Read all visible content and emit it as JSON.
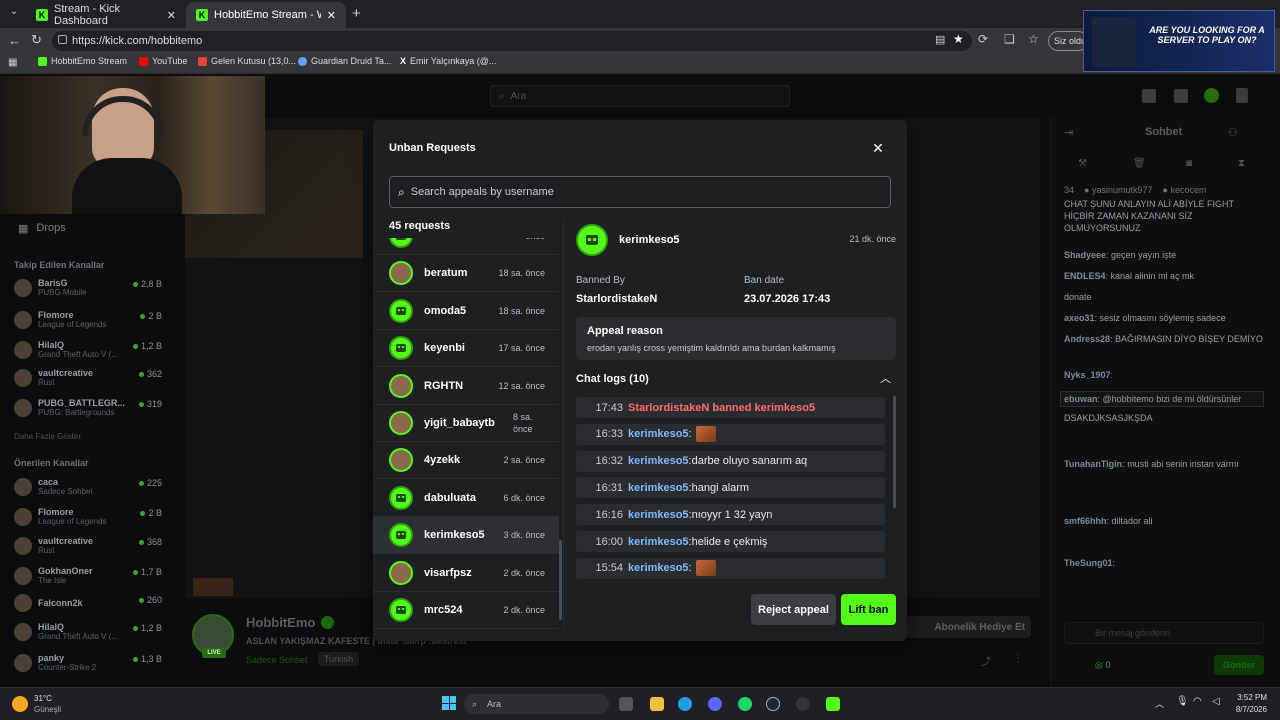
{
  "browser": {
    "tabs": [
      {
        "title": "Stream - Kick Dashboard",
        "active": false
      },
      {
        "title": "HobbitEmo Stream - Watch Live o",
        "active": true
      }
    ],
    "url": "https://kick.com/hobbitemo",
    "profile_button": "Siz oldu",
    "bookmarks": [
      {
        "label": "HobbitEmo Stream",
        "color": "#53fc18"
      },
      {
        "label": "YouTube",
        "color": "#ff0000"
      },
      {
        "label": "Gelen Kutusu (13,0...",
        "color": "#ea4335"
      },
      {
        "label": "Guardian Druid Ta...",
        "color": "#6aa0ff"
      },
      {
        "label": "Emir Yalçınkaya (@...",
        "color": "#ffffff"
      }
    ]
  },
  "ad": {
    "text": "ARE YOU LOOKING FOR A SERVER TO PLAY ON?"
  },
  "page": {
    "search_placeholder": "Ara",
    "sidebar": {
      "drops": "Drops",
      "followed_header": "Takip Edilen Kanallar",
      "followed": [
        {
          "name": "BarisG",
          "game": "PUBG Mobile",
          "count": "2,8 B"
        },
        {
          "name": "Flomore",
          "game": "League of Legends",
          "count": "2 B"
        },
        {
          "name": "HilalQ",
          "game": "Grand Theft Auto V (...",
          "count": "1,2 B"
        },
        {
          "name": "vaultcreative",
          "game": "Rust",
          "count": "362"
        },
        {
          "name": "PUBG_BATTLEGR...",
          "game": "PUBG: Battlegrounds",
          "count": "319"
        }
      ],
      "show_more": "Daha Fazla Göster",
      "recommended_header": "Önerilen Kanallar",
      "recommended": [
        {
          "name": "caca",
          "game": "Sadece Sohbet",
          "count": "225"
        },
        {
          "name": "Flomore",
          "game": "League of Legends",
          "count": "2 B"
        },
        {
          "name": "vaultcreative",
          "game": "Rust",
          "count": "368"
        },
        {
          "name": "GokhanOner",
          "game": "The Isle",
          "count": "1,7 B"
        },
        {
          "name": "Falconn2k",
          "game": "",
          "count": "260"
        },
        {
          "name": "HilalQ",
          "game": "Grand Theft Auto V (...",
          "count": "1,2 B"
        },
        {
          "name": "panky",
          "game": "Counter-Strike 2",
          "count": "1,3 B"
        }
      ]
    },
    "streamer": {
      "name": "HobbitEmo",
      "title": "ASLAN YAKIŞMAZ KAFESTE | insta :bierp :bestrest",
      "category": "Sadece Sohbet",
      "tag": "Turkish",
      "live": "LIVE",
      "subscribe": "Abonelik Hediye Et"
    },
    "chat": {
      "title": "Sohbet",
      "top_count": "34",
      "pinned_users": [
        "yasinumutk977",
        "kecocem"
      ],
      "lines": [
        {
          "user": "",
          "text": "CHAT ŞUNU ANLAYIN ALİ ABİYLE FIGHT HİÇBİR ZAMAN KAZANANI SİZ OLMUYORSUNUZ"
        },
        {
          "user": "Shadyeee",
          "text": "geçen yayın işte"
        },
        {
          "user": "ENDLES4",
          "text": "kanal alinin mi aç mk"
        },
        {
          "user": "",
          "text": "donate"
        },
        {
          "user": "axeo31",
          "text": "sesiz olmasını söylemiş sadece"
        },
        {
          "user": "Andress28",
          "text": "BAĞIRMASIN DİYO BİŞEY DEMİYO"
        },
        {
          "user": "Nyks_1907",
          "text": ""
        },
        {
          "user": "ebuwan",
          "text": "@hobbitemo bizi de mi öldürsünler"
        },
        {
          "user": "",
          "text": "DSAKDJKSASJKŞDA"
        },
        {
          "user": "TunahanTigin",
          "text": "musti abi senin instan varmı"
        },
        {
          "user": "smf66hhh",
          "text": "diltador ali"
        },
        {
          "user": "TheSung01",
          "text": ""
        }
      ],
      "input_placeholder": "Bir mesaj gönderin",
      "send": "Gönder",
      "points": "0"
    }
  },
  "modal": {
    "title": "Unban Requests",
    "search_placeholder": "Search appeals by username",
    "count_label": "45 requests",
    "requests": [
      {
        "username": "",
        "time": "önce",
        "photo": false
      },
      {
        "username": "beratum",
        "time": "18 sa. önce",
        "photo": true
      },
      {
        "username": "omoda5",
        "time": "18 sa. önce",
        "photo": false
      },
      {
        "username": "keyenbi",
        "time": "17 sa. önce",
        "photo": false
      },
      {
        "username": "RGHTN",
        "time": "12 sa. önce",
        "photo": true
      },
      {
        "username": "yigit_babaytb",
        "time": "8 sa. önce",
        "photo": true
      },
      {
        "username": "4yzekk",
        "time": "2 sa. önce",
        "photo": true
      },
      {
        "username": "dabuluata",
        "time": "6 dk. önce",
        "photo": false
      },
      {
        "username": "kerimkeso5",
        "time": "3 dk. önce",
        "photo": false,
        "selected": true
      },
      {
        "username": "visarfpsz",
        "time": "2 dk. önce",
        "photo": true
      },
      {
        "username": "mrc524",
        "time": "2 dk. önce",
        "photo": false
      }
    ],
    "detail": {
      "username": "kerimkeso5",
      "time": "21 dk. önce",
      "banned_by_label": "Banned By",
      "banned_by": "StarlordistakeN",
      "ban_date_label": "Ban date",
      "ban_date": "23.07.2026 17:43",
      "appeal_reason_label": "Appeal reason",
      "appeal_reason": "erodan yanlış cross yemiştim kaldırıldı ama burdan kalkmamış",
      "chat_logs_label": "Chat logs (10)",
      "logs": [
        {
          "time": "17:43",
          "user": "",
          "text": "StarlordistakeN banned kerimkeso5",
          "ban": true,
          "emote": false
        },
        {
          "time": "16:33",
          "user": "kerimkeso5",
          "text": "",
          "ban": false,
          "emote": true
        },
        {
          "time": "16:32",
          "user": "kerimkeso5",
          "text": "darbe oluyo sanarım aq",
          "ban": false,
          "emote": false
        },
        {
          "time": "16:31",
          "user": "kerimkeso5",
          "text": "hangi alarm",
          "ban": false,
          "emote": false
        },
        {
          "time": "16:16",
          "user": "kerimkeso5",
          "text": "nıoyyr 1 32 yayn",
          "ban": false,
          "emote": false
        },
        {
          "time": "16:00",
          "user": "kerimkeso5",
          "text": "helide e çekmiş",
          "ban": false,
          "emote": false
        },
        {
          "time": "15:54",
          "user": "kerimkeso5",
          "text": "",
          "ban": false,
          "emote": true
        }
      ],
      "reject_label": "Reject appeal",
      "lift_label": "Lift ban"
    }
  },
  "taskbar": {
    "weather_temp": "31°C",
    "weather_desc": "Güneşli",
    "search": "Ara",
    "time": "3:52 PM",
    "date": "8/7/2026"
  },
  "colors": {
    "kick_green": "#53fc18",
    "username_blue": "#7fb8ff",
    "ban_red": "#ff6b6b"
  }
}
